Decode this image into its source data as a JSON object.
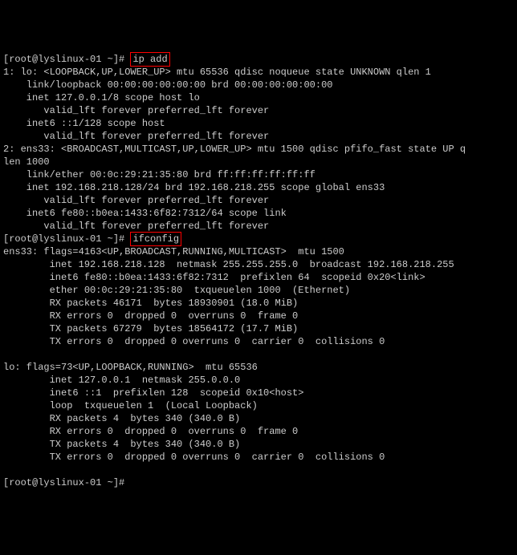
{
  "prompt1": "[root@lyslinux-01 ~]# ",
  "cmd1": "ip add",
  "ipadd": [
    "1: lo: <LOOPBACK,UP,LOWER_UP> mtu 65536 qdisc noqueue state UNKNOWN qlen 1",
    "    link/loopback 00:00:00:00:00:00 brd 00:00:00:00:00:00",
    "    inet 127.0.0.1/8 scope host lo",
    "       valid_lft forever preferred_lft forever",
    "    inet6 ::1/128 scope host",
    "       valid_lft forever preferred_lft forever",
    "2: ens33: <BROADCAST,MULTICAST,UP,LOWER_UP> mtu 1500 qdisc pfifo_fast state UP q",
    "len 1000",
    "    link/ether 00:0c:29:21:35:80 brd ff:ff:ff:ff:ff:ff",
    "    inet 192.168.218.128/24 brd 192.168.218.255 scope global ens33",
    "       valid_lft forever preferred_lft forever",
    "    inet6 fe80::b0ea:1433:6f82:7312/64 scope link",
    "       valid_lft forever preferred_lft forever"
  ],
  "prompt2": "[root@lyslinux-01 ~]# ",
  "cmd2": "ifconfig",
  "ifconfig": [
    "ens33: flags=4163<UP,BROADCAST,RUNNING,MULTICAST>  mtu 1500",
    "        inet 192.168.218.128  netmask 255.255.255.0  broadcast 192.168.218.255",
    "        inet6 fe80::b0ea:1433:6f82:7312  prefixlen 64  scopeid 0x20<link>",
    "        ether 00:0c:29:21:35:80  txqueuelen 1000  (Ethernet)",
    "        RX packets 46171  bytes 18930901 (18.0 MiB)",
    "        RX errors 0  dropped 0  overruns 0  frame 0",
    "        TX packets 67279  bytes 18564172 (17.7 MiB)",
    "        TX errors 0  dropped 0 overruns 0  carrier 0  collisions 0",
    "",
    "lo: flags=73<UP,LOOPBACK,RUNNING>  mtu 65536",
    "        inet 127.0.0.1  netmask 255.0.0.0",
    "        inet6 ::1  prefixlen 128  scopeid 0x10<host>",
    "        loop  txqueuelen 1  (Local Loopback)",
    "        RX packets 4  bytes 340 (340.0 B)",
    "        RX errors 0  dropped 0  overruns 0  frame 0",
    "        TX packets 4  bytes 340 (340.0 B)",
    "        TX errors 0  dropped 0 overruns 0  carrier 0  collisions 0",
    ""
  ],
  "prompt3": "[root@lyslinux-01 ~]# "
}
